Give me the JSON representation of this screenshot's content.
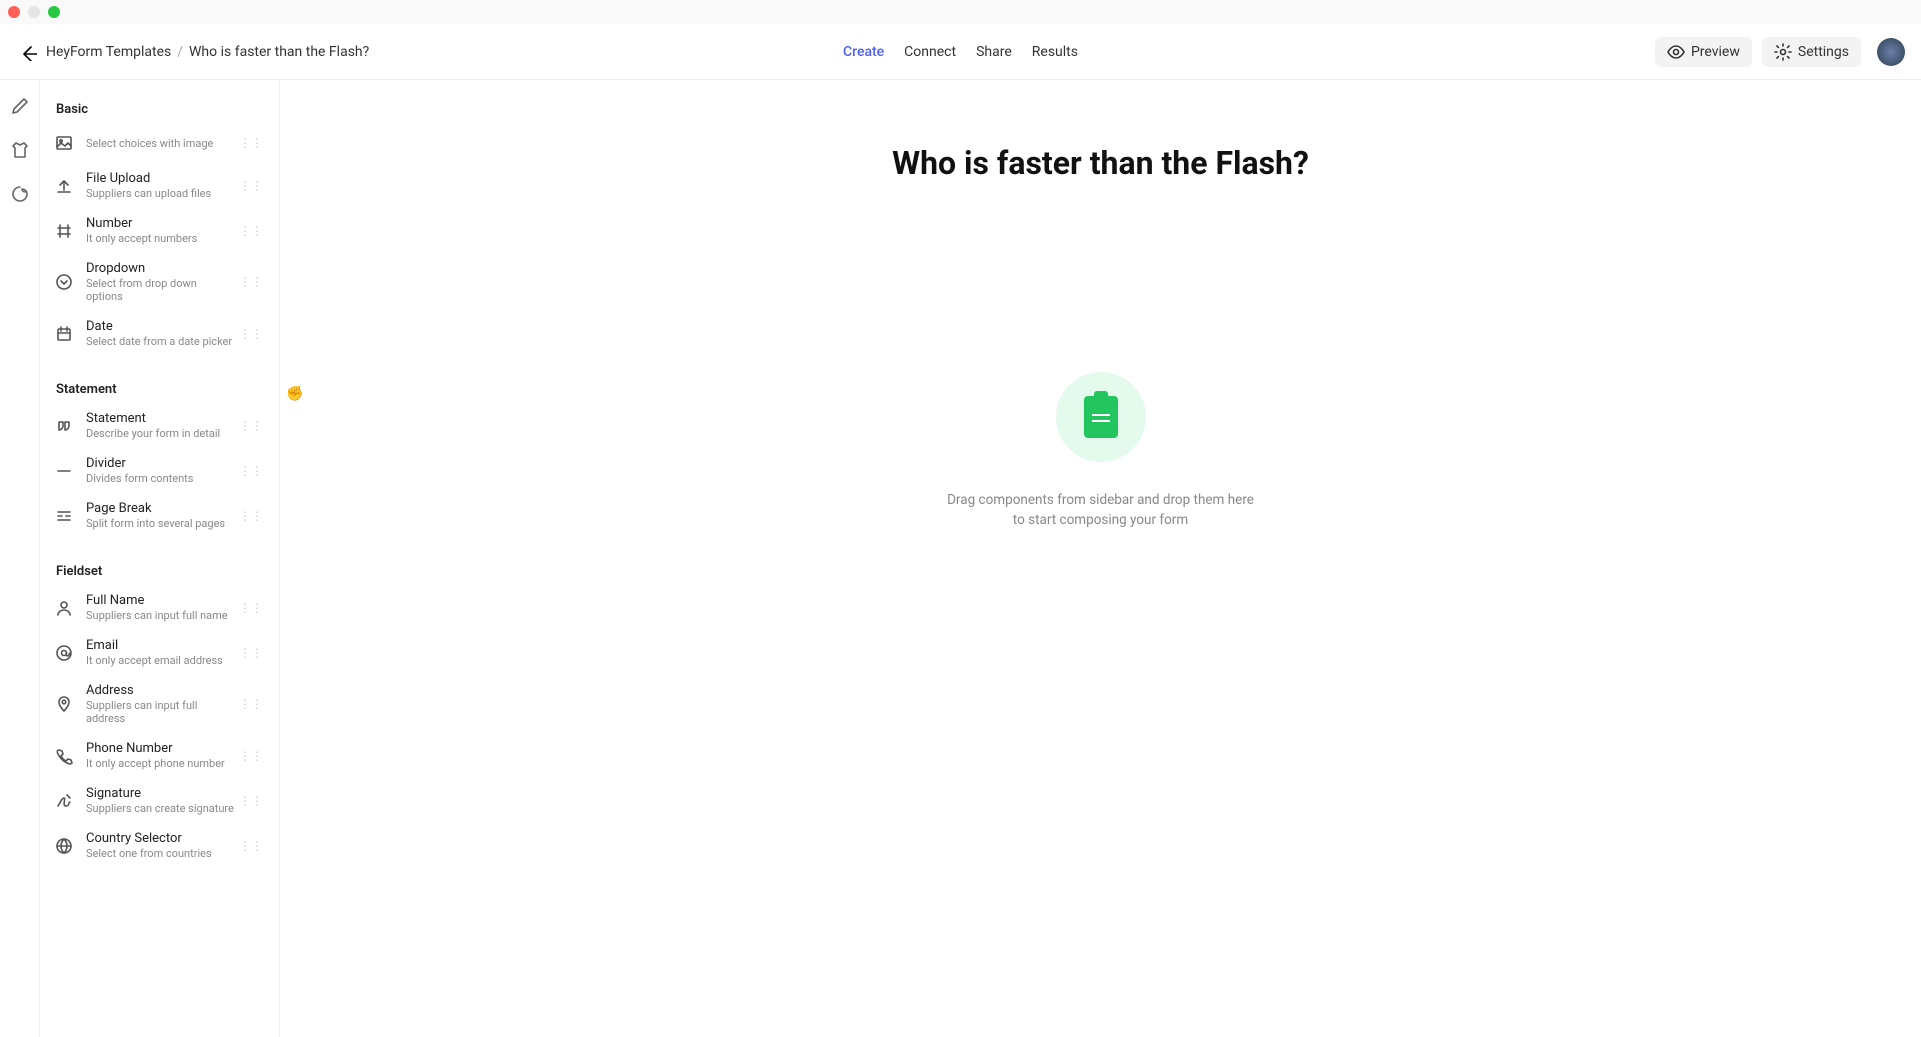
{
  "breadcrumbs": {
    "root": "HeyForm Templates",
    "current": "Who is faster than the Flash?"
  },
  "tabs": {
    "create": "Create",
    "connect": "Connect",
    "share": "Share",
    "results": "Results"
  },
  "header_buttons": {
    "preview": "Preview",
    "settings": "Settings"
  },
  "form": {
    "title": "Who is faster than the Flash?",
    "empty": "Drag components from sidebar and drop them here to start composing your form"
  },
  "sidebar": {
    "groups": [
      {
        "title": "Basic",
        "items": [
          {
            "title": "",
            "desc": "Select choices with image"
          },
          {
            "title": "File Upload",
            "desc": "Suppliers can upload files"
          },
          {
            "title": "Number",
            "desc": "It only accept numbers"
          },
          {
            "title": "Dropdown",
            "desc": "Select from drop down options"
          },
          {
            "title": "Date",
            "desc": "Select date from a date picker"
          }
        ]
      },
      {
        "title": "Statement",
        "items": [
          {
            "title": "Statement",
            "desc": "Describe your form in detail"
          },
          {
            "title": "Divider",
            "desc": "Divides form contents"
          },
          {
            "title": "Page Break",
            "desc": "Split form into several pages"
          }
        ]
      },
      {
        "title": "Fieldset",
        "items": [
          {
            "title": "Full Name",
            "desc": "Suppliers can input full name"
          },
          {
            "title": "Email",
            "desc": "It only accept email address"
          },
          {
            "title": "Address",
            "desc": "Suppliers can input full address"
          },
          {
            "title": "Phone Number",
            "desc": "It only accept phone number"
          },
          {
            "title": "Signature",
            "desc": "Suppliers can create signature"
          },
          {
            "title": "Country Selector",
            "desc": "Select one from countries"
          }
        ]
      }
    ]
  }
}
